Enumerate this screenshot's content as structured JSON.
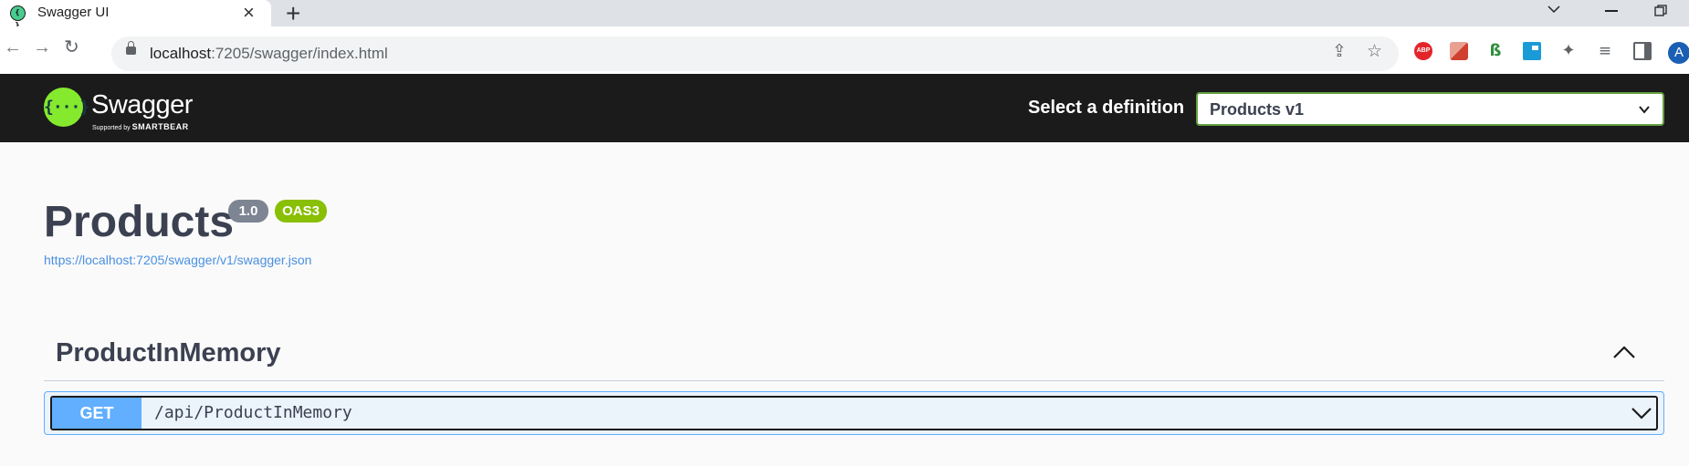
{
  "browser": {
    "tab_title": "Swagger UI",
    "tab_close_icon": "close-icon",
    "new_tab_label": "+",
    "url_host": "localhost",
    "url_path": ":7205/swagger/index.html",
    "extensions": [
      "ABP"
    ],
    "profile_initial": "A"
  },
  "swagger": {
    "logo_text": "Swagger",
    "logo_sub_prefix": "Supported by",
    "logo_sub_brand": "SMARTBEAR",
    "definition_label": "Select a definition",
    "definition_value": "Products v1",
    "info": {
      "title": "Products",
      "version": "1.0",
      "oas": "OAS3",
      "spec_url": "https://localhost:7205/swagger/v1/swagger.json"
    },
    "tag": {
      "name": "ProductInMemory",
      "expanded": true
    },
    "operations": [
      {
        "method": "GET",
        "path": "/api/ProductInMemory"
      }
    ]
  },
  "colors": {
    "topbar": "#1b1b1b",
    "logo_green": "#85ea2d",
    "get_blue": "#61affe",
    "version_badge": "#7d8492",
    "oas_badge": "#89bf04",
    "link": "#4990e2"
  }
}
